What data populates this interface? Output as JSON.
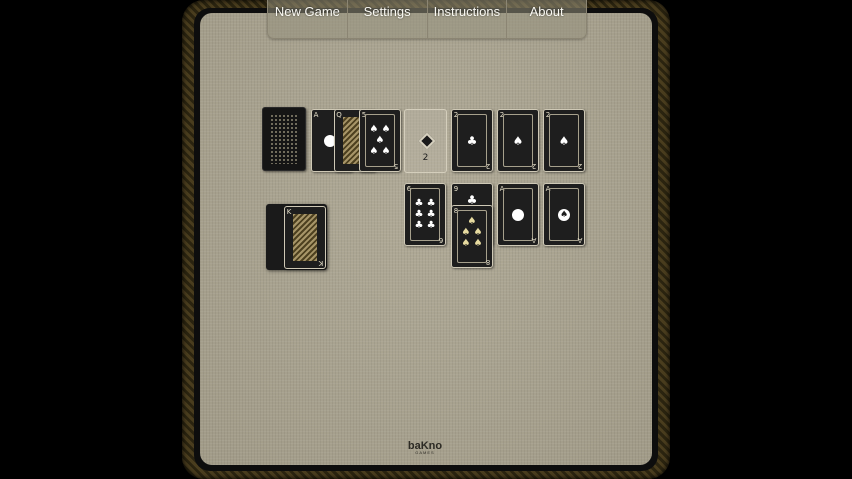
{
  "menu": {
    "items": [
      "New Game",
      "Settings",
      "Instructions",
      "About"
    ]
  },
  "colors": {
    "felt": "#a8a290",
    "card_face": "#1e1e1e",
    "frame": "#3a3018"
  },
  "stock": {
    "icon": "card-back-pattern"
  },
  "waste": {
    "cards": [
      {
        "rank": "A",
        "suit_icon": "ring-icon"
      },
      {
        "rank": "Q",
        "suit_icon": "club-icon"
      },
      {
        "rank": "5",
        "suit_icon": "spade-icon"
      }
    ]
  },
  "foundation_slot": {
    "icon": "diamond-icon",
    "count": "2"
  },
  "foundations": [
    {
      "rank": "2",
      "suit": "♣"
    },
    {
      "rank": "2",
      "suit": "♠"
    },
    {
      "rank": "2",
      "suit": "♠"
    }
  ],
  "tableau": [
    {
      "rank": "6",
      "suit": "♣"
    },
    {
      "rank": "9",
      "suit": "♣"
    },
    {
      "rank": "8",
      "suit": "♠"
    },
    {
      "rank": "A",
      "suit_icon": "ring-icon"
    },
    {
      "rank": "A",
      "suit": "♠"
    }
  ],
  "hand": {
    "rank": "K",
    "suit_icon": "king-portrait"
  },
  "logo": {
    "main": "baKno",
    "sub": "GAMES"
  }
}
